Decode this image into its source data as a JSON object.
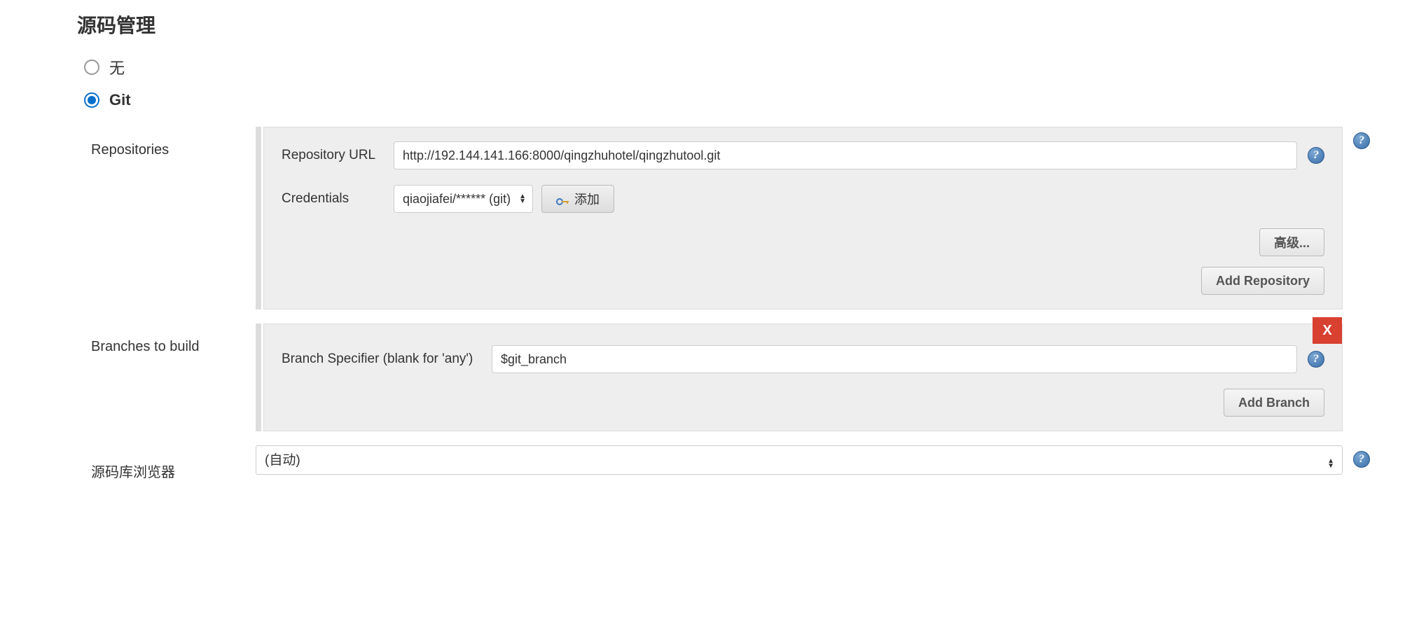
{
  "scm": {
    "title": "源码管理",
    "options": {
      "none": "无",
      "git": "Git"
    }
  },
  "repositories": {
    "label": "Repositories",
    "url_label": "Repository URL",
    "url_value": "http://192.144.141.166:8000/qingzhuhotel/qingzhutool.git",
    "credentials_label": "Credentials",
    "credentials_value": "qiaojiafei/****** (git)",
    "add_button": "添加",
    "advanced_button": "高级...",
    "add_repo_button": "Add Repository"
  },
  "branches": {
    "label": "Branches to build",
    "specifier_label": "Branch Specifier (blank for 'any')",
    "specifier_value": "$git_branch",
    "delete_label": "X",
    "add_branch_button": "Add Branch"
  },
  "browser": {
    "label": "源码库浏览器",
    "value": "(自动)"
  },
  "help": "?"
}
